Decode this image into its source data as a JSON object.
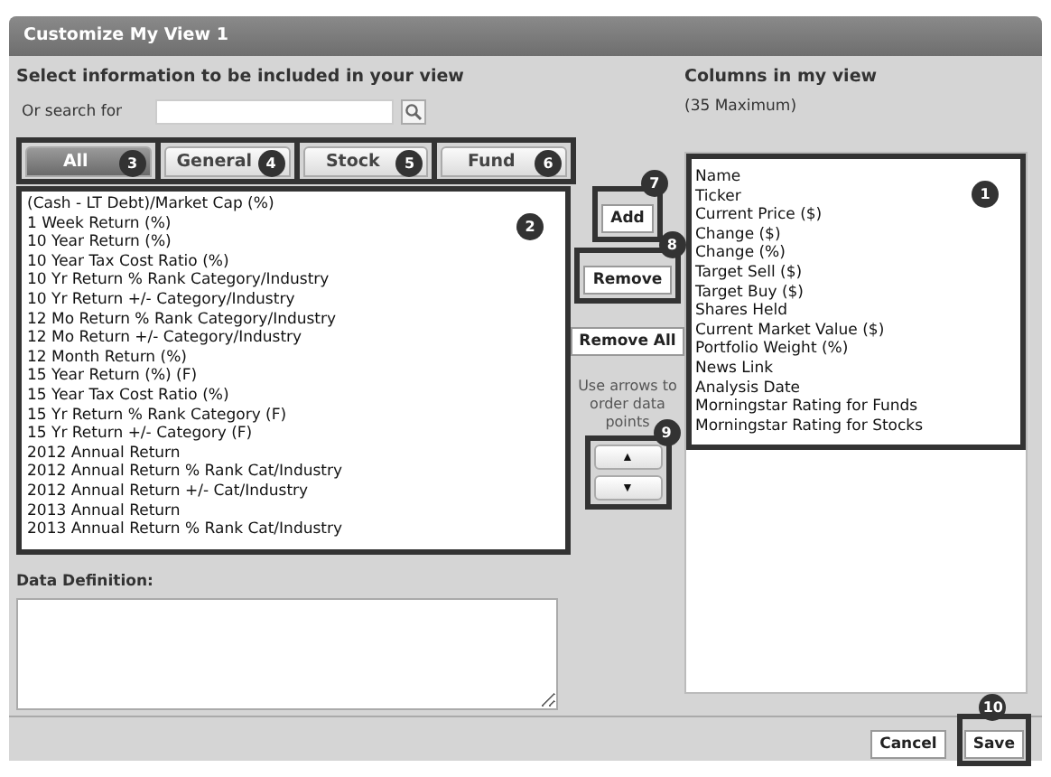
{
  "window": {
    "title": "Customize My View 1"
  },
  "available": {
    "heading": "Select information to be included in your view",
    "search_label": "Or search for",
    "tabs": [
      {
        "label": "All",
        "selected": true,
        "badge": "3"
      },
      {
        "label": "General",
        "selected": false,
        "badge": "4"
      },
      {
        "label": "Stock",
        "selected": false,
        "badge": "5"
      },
      {
        "label": "Fund",
        "selected": false,
        "badge": "6"
      }
    ],
    "badge": "2",
    "items": [
      "(Cash - LT Debt)/Market Cap (%)",
      "1 Week Return (%)",
      "10 Year Return (%)",
      "10 Year Tax Cost Ratio (%)",
      "10 Yr Return % Rank Category/Industry",
      "10 Yr Return +/- Category/Industry",
      "12 Mo Return % Rank Category/Industry",
      "12 Mo Return +/- Category/Industry",
      "12 Month Return (%)",
      "15 Year Return (%) (F)",
      "15 Year Tax Cost Ratio (%)",
      "15 Yr Return % Rank Category (F)",
      "15 Yr Return +/- Category (F)",
      "2012 Annual Return",
      "2012 Annual Return % Rank Cat/Industry",
      "2012 Annual Return +/- Cat/Industry",
      "2013 Annual Return",
      "2013 Annual Return % Rank Cat/Industry"
    ]
  },
  "controls": {
    "buttons": [
      {
        "label": "Add",
        "badge": "7",
        "framed": true
      },
      {
        "label": "Remove",
        "badge": "8",
        "framed": true
      },
      {
        "label": "Remove All",
        "framed": false
      }
    ],
    "hint": "Use arrows to order data points",
    "arrows": [
      "▲",
      "▼"
    ],
    "arrows_badge": "9"
  },
  "selected_columns": {
    "heading": "Columns in my view",
    "note": "(35 Maximum)",
    "badge": "1",
    "items": [
      "Name",
      "Ticker",
      "Current Price ($)",
      "Change ($)",
      "Change (%)",
      "Target Sell ($)",
      "Target Buy ($)",
      "Shares Held",
      "Current Market Value ($)",
      "Portfolio Weight (%)",
      "News Link",
      "Analysis Date",
      "Morningstar Rating for Funds",
      "Morningstar Rating for Stocks"
    ]
  },
  "definition": {
    "label": "Data Definition:"
  },
  "footer": {
    "buttons": [
      {
        "label": "Cancel"
      },
      {
        "label": "Save",
        "badge": "10"
      }
    ]
  }
}
